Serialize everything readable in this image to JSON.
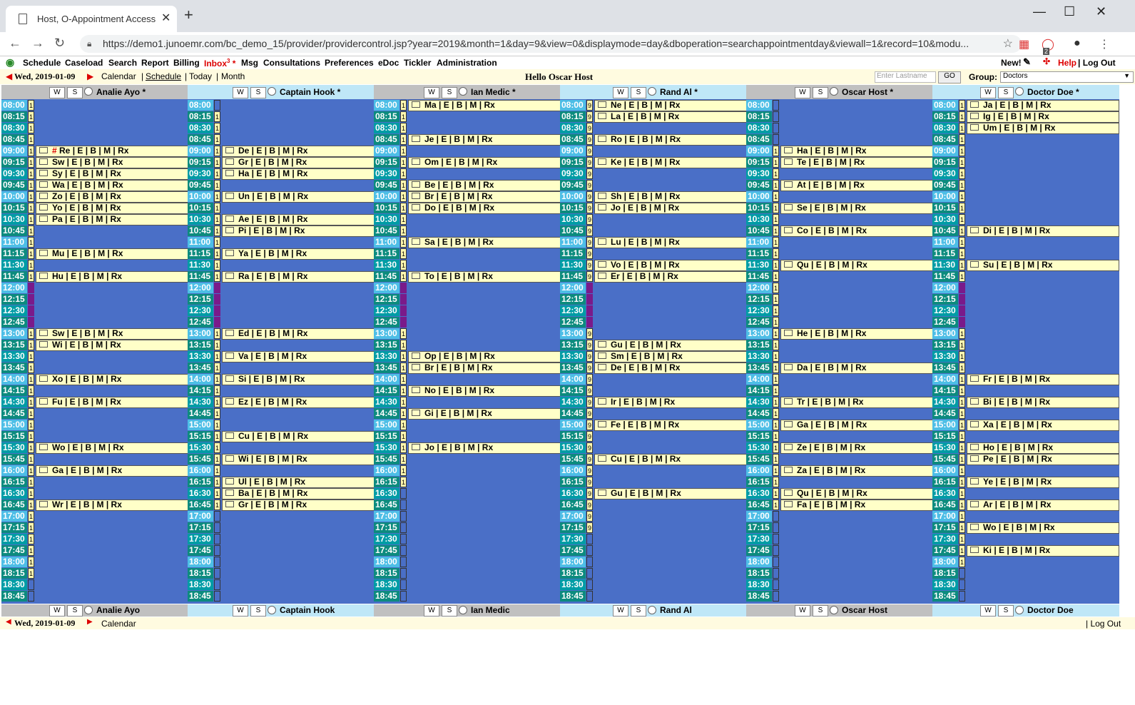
{
  "browser": {
    "tab_title": "Host, O-Appointment Access",
    "url": "https://demo1.junoemr.com/bc_demo_15/provider/providercontrol.jsp?year=2019&month=1&day=9&view=0&displaymode=day&dboperation=searchappointmentday&viewall=1&record=10&modu...",
    "ext_badge": "2"
  },
  "menu": {
    "items": [
      "Schedule",
      "Caseload",
      "Search",
      "Report",
      "Billing",
      "Inbox",
      "Msg",
      "Consultations",
      "Preferences",
      "eDoc",
      "Tickler",
      "Administration"
    ],
    "inbox_count": "3",
    "inbox_star": "*",
    "new_label": "New!",
    "help_label": "Help",
    "logout_label": "| Log Out"
  },
  "nav": {
    "date": "Wed, 2019-01-09",
    "calendar": "Calendar",
    "schedule": "Schedule",
    "today": "Today",
    "month": "Month",
    "sep": "|",
    "greeting": "Hello Oscar Host",
    "search_placeholder": "Enter Lastname",
    "go_label": "GO",
    "group_label": "Group:",
    "group_value": "Doctors"
  },
  "footer": {
    "date": "Wed, 2019-01-09",
    "calendar": "Calendar",
    "logout": "| Log Out"
  },
  "week_label": "W",
  "sched_label": "S",
  "appt_suffix": "| E | B | M | Rx",
  "times": [
    "08:00",
    "08:15",
    "08:30",
    "08:45",
    "09:00",
    "09:15",
    "09:30",
    "09:45",
    "10:00",
    "10:15",
    "10:30",
    "10:45",
    "11:00",
    "11:15",
    "11:30",
    "11:45",
    "12:00",
    "12:15",
    "12:30",
    "12:45",
    "13:00",
    "13:15",
    "13:30",
    "13:45",
    "14:00",
    "14:15",
    "14:30",
    "14:45",
    "15:00",
    "15:15",
    "15:30",
    "15:45",
    "16:00",
    "16:15",
    "16:30",
    "16:45",
    "17:00",
    "17:15",
    "17:30",
    "17:45",
    "18:00",
    "18:15",
    "18:30",
    "18:45"
  ],
  "providers": [
    {
      "name": "Analie Ayo *",
      "footer_name": "Analie Ayo",
      "hdr_bg": "#c0c0c0",
      "ind": "1111111111111111LLLL1111111111111111111111__",
      "appts": {
        "09:00": "# Re",
        "09:15": "Sw",
        "09:30": "Sy",
        "09:45": "Wa",
        "10:00": "Zo",
        "10:15": "Yo",
        "10:30": "Pa",
        "11:15": "Mu",
        "11:45": "Hu",
        "13:00": "Sw",
        "13:15": "Wi",
        "14:00": "Xo",
        "14:30": "Fu",
        "15:30": "Wo",
        "16:00": "Ga",
        "16:45": "Wr"
      }
    },
    {
      "name": "Captain Hook *",
      "footer_name": "Captain Hook",
      "hdr_bg": "#bfe7f7",
      "ind": "_111111111111111LLLL1111111111111111________",
      "appts": {
        "09:00": "De",
        "09:15": "Gr",
        "09:30": "Ha",
        "10:00": "Un",
        "10:30": "Ae",
        "10:45": "Pi",
        "11:15": "Ya",
        "11:45": "Ra",
        "13:00": "Ed",
        "13:30": "Va",
        "14:00": "Si",
        "14:30": "Ez",
        "15:15": "Cu",
        "15:45": "Wi",
        "16:15": "Ul",
        "16:30": "Ba",
        "16:45": "Gr"
      }
    },
    {
      "name": "Ian Medic *",
      "footer_name": "Ian Medic",
      "hdr_bg": "#c0c0c0",
      "ind": "1111111111111111LLLL11111111111111__________",
      "appts": {
        "08:00": "Ma",
        "08:45": "Je",
        "09:15": "Om",
        "09:45": "Be",
        "10:00": "Br",
        "10:15": "Do",
        "11:00": "Sa",
        "11:45": "To",
        "13:30": "Op",
        "13:45": "Br",
        "14:15": "No",
        "14:45": "Gi",
        "15:30": "Jo"
      }
    },
    {
      "name": "Rand Al *",
      "footer_name": "Rand Al",
      "hdr_bg": "#bfe7f7",
      "ind": "9999999999999999LLLL999999999999999999______",
      "appts": {
        "08:00": "Ne",
        "08:15": "La",
        "08:45": "Ro",
        "09:15": "Ke",
        "10:00": "Sh",
        "10:15": "Jo",
        "11:00": "Lu",
        "11:30": "Vo",
        "11:45": "Er",
        "13:15": "Gu",
        "13:30": "Sm",
        "13:45": "De",
        "14:30": "Ir",
        "15:00": "Fe",
        "15:45": "Cu",
        "16:30": "Gu"
      }
    },
    {
      "name": "Oscar Host *",
      "footer_name": "Oscar Host",
      "hdr_bg": "#c0c0c0",
      "ind": "____11111111111111111111111111111111________",
      "appts": {
        "09:00": "Ha",
        "09:15": "Te",
        "09:45": "At",
        "10:15": "Se",
        "10:45": "Co",
        "11:30": "Qu",
        "13:00": "He",
        "13:45": "Da",
        "14:30": "Tr",
        "15:00": "Ga",
        "15:30": "Ze",
        "16:00": "Za",
        "16:30": "Qu",
        "16:45": "Fa"
      }
    },
    {
      "name": "Doctor Doe *",
      "footer_name": "Doctor Doe",
      "hdr_bg": "#bfe7f7",
      "ind": "1111111111111111LLLL111111111111111111111___",
      "appts": {
        "08:00": "Ja",
        "08:15": "Ig",
        "08:30": "Um",
        "10:45": "Di",
        "11:30": "Su",
        "14:00": "Fr",
        "14:30": "Bi",
        "15:00": "Xa",
        "15:30": "Ho",
        "15:45": "Pe",
        "16:15": "Ye",
        "16:45": "Ar",
        "17:15": "Wo",
        "17:45": "Ki"
      }
    }
  ]
}
